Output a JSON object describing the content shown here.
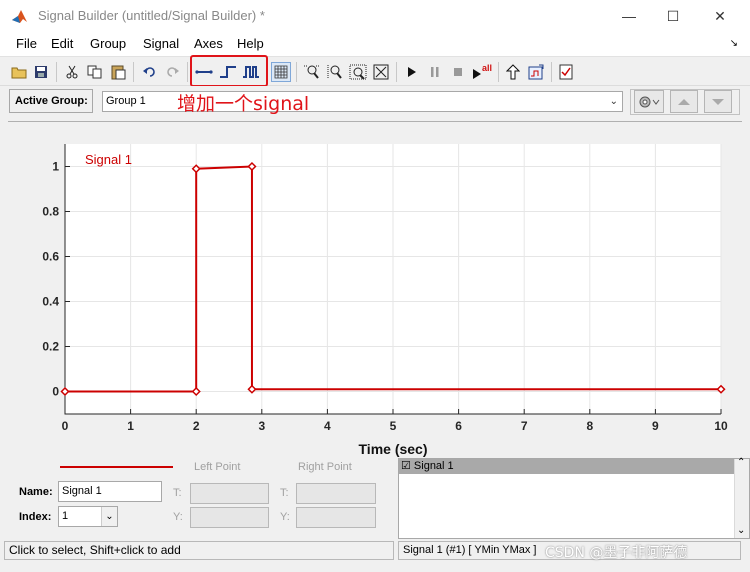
{
  "window": {
    "title": "Signal Builder (untitled/Signal Builder) *",
    "min_glyph": "—",
    "max_glyph": "☐",
    "close_glyph": "✕"
  },
  "menu": {
    "items": [
      "File",
      "Edit",
      "Group",
      "Signal",
      "Axes",
      "Help"
    ],
    "overflow_glyph": "↘"
  },
  "toolbar": {
    "all_label": "all"
  },
  "group_row": {
    "active_group_label": "Active Group:",
    "selected_group": "Group 1",
    "dropdown_glyph": "⌄",
    "annotation": "增加一个signal"
  },
  "chart_data": {
    "type": "line",
    "series": [
      {
        "name": "Signal 1",
        "x": [
          0,
          2,
          2,
          2.85,
          2.85,
          10
        ],
        "y": [
          0,
          0,
          0.99,
          1.0,
          0.01,
          0.01
        ]
      }
    ],
    "xlabel": "Time (sec)",
    "ylabel": "",
    "xlim": [
      0,
      10
    ],
    "ylim": [
      -0.1,
      1.1
    ],
    "x_ticks": [
      "0",
      "1",
      "2",
      "3",
      "4",
      "5",
      "6",
      "7",
      "8",
      "9",
      "10"
    ],
    "y_ticks": [
      "0",
      "0.2",
      "0.4",
      "0.6",
      "0.8",
      "1"
    ],
    "grid": true,
    "series_color": "#cc0000"
  },
  "bottom": {
    "left_point_label": "Left Point",
    "right_point_label": "Right Point",
    "t_label": "T:",
    "y_label": "Y:",
    "name_label": "Name:",
    "name_value": "Signal 1",
    "index_label": "Index:",
    "index_value": "1",
    "index_glyph": "⌄",
    "list_item": "☑ Signal 1",
    "scroll_up": "⌃",
    "scroll_down": "⌄"
  },
  "status": {
    "left": "Click to select, Shift+click to add",
    "right": "Signal 1 (#1)  [ YMin YMax ]"
  },
  "watermark": "CSDN @墨子非阿萨德"
}
